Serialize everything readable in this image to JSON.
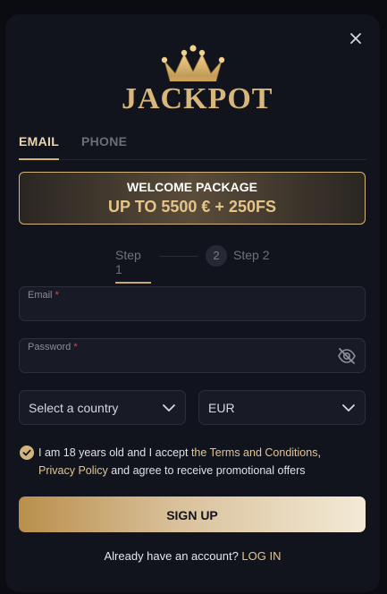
{
  "brand": {
    "logo_main": "JACKPOT",
    "colors": {
      "accent": "#d5b26e",
      "panel": "#12141d"
    }
  },
  "tabs": [
    {
      "label": "EMAIL",
      "active": true
    },
    {
      "label": "PHONE",
      "active": false
    }
  ],
  "promo": {
    "title": "WELCOME PACKAGE",
    "subtitle": "UP TO 5500 € + 250FS"
  },
  "steps": [
    {
      "label": "Step 1",
      "active": true
    },
    {
      "number": "2",
      "label": "Step 2",
      "active": false
    }
  ],
  "form": {
    "email": {
      "label": "Email",
      "required_mark": "*",
      "value": ""
    },
    "password": {
      "label": "Password",
      "required_mark": "*",
      "value": "",
      "toggle_icon": "eye-slash-icon"
    },
    "country": {
      "value": "Select a country",
      "icon": "chevron-down-icon"
    },
    "currency": {
      "value": "EUR",
      "icon": "chevron-down-icon"
    },
    "consent": {
      "checked": true,
      "text_before": "I am 18 years old and I accept ",
      "terms_link": "the Terms and Conditions",
      "comma": ", ",
      "privacy_link": "Privacy Policy",
      "text_after": " and agree to receive promotional offers"
    },
    "submit_label": "SIGN UP"
  },
  "footer": {
    "prompt": "Already have an account? ",
    "login_link": "LOG IN"
  },
  "close_icon": "close-icon"
}
